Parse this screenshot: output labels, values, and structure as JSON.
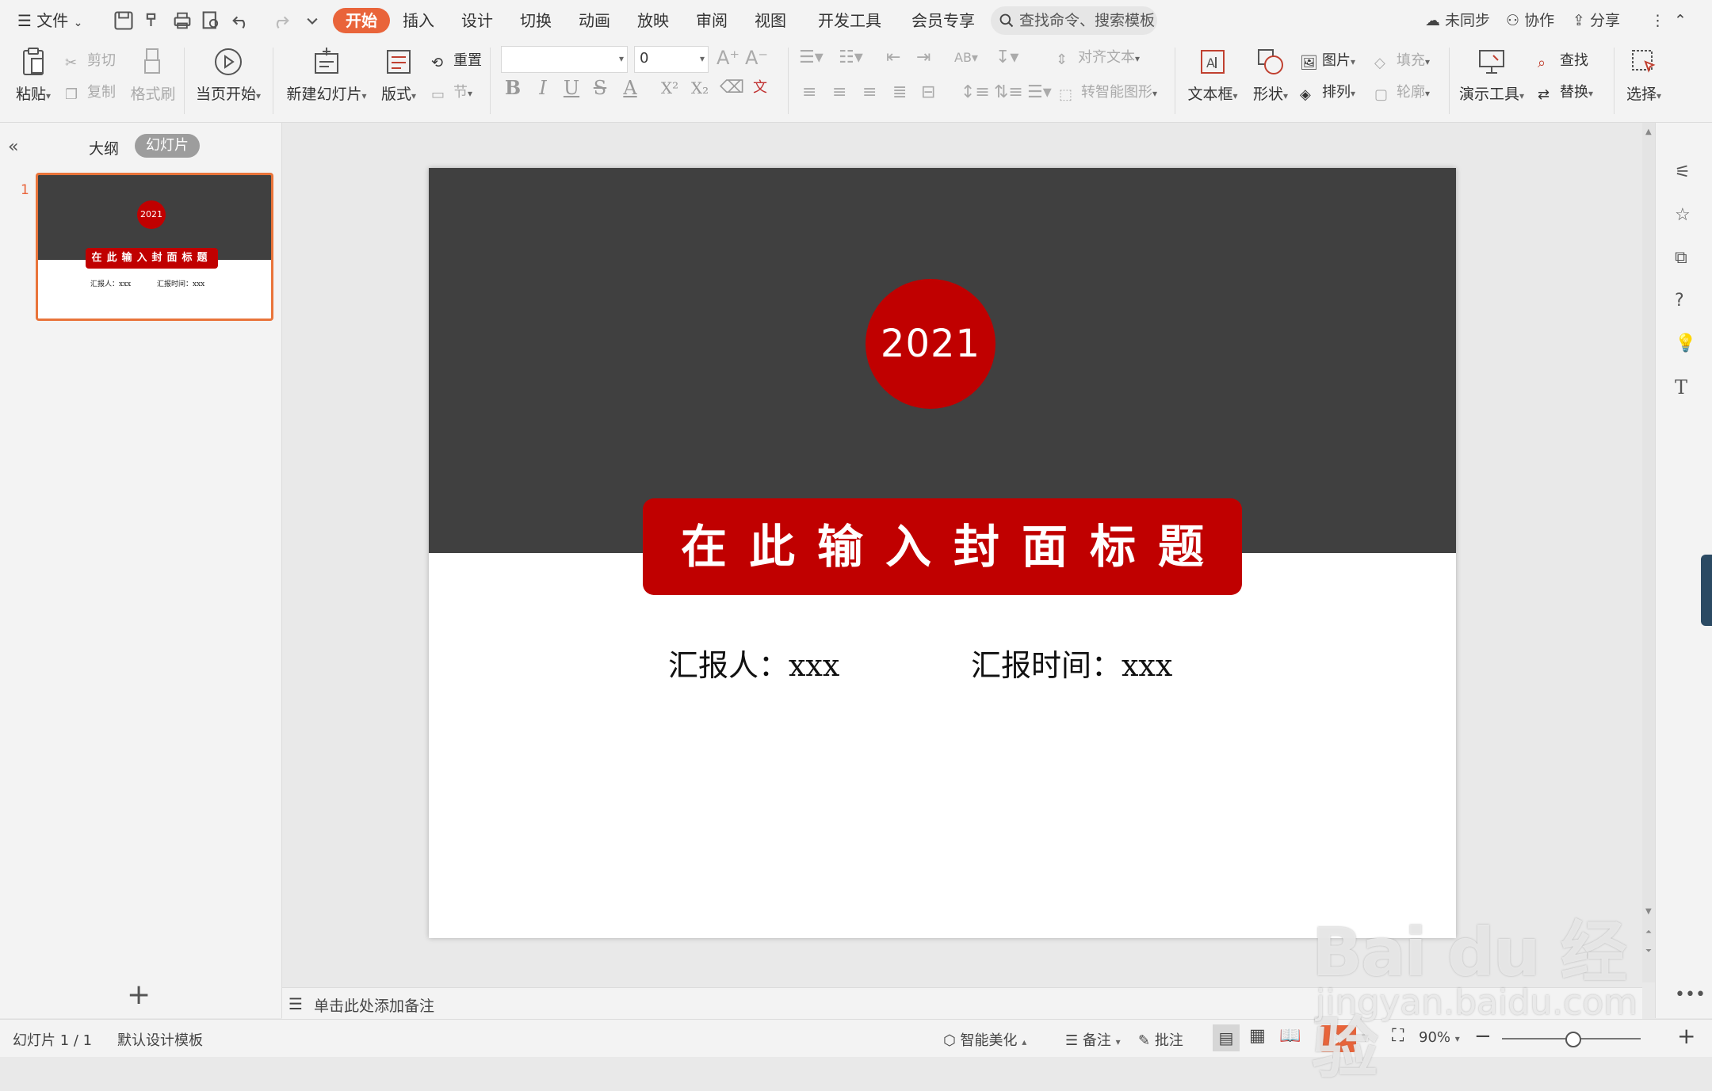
{
  "menubar": {
    "file": "文件",
    "tabs": [
      "开始",
      "插入",
      "设计",
      "切换",
      "动画",
      "放映",
      "审阅",
      "视图",
      "开发工具",
      "会员专享"
    ],
    "search_placeholder": "查找命令、搜索模板",
    "unsynced": "未同步",
    "collaborate": "协作",
    "share": "分享"
  },
  "ribbon": {
    "paste": "粘贴",
    "cut": "剪切",
    "copy": "复制",
    "format_painter": "格式刷",
    "from_current": "当页开始",
    "new_slide": "新建幻灯片",
    "layout": "版式",
    "reset": "重置",
    "section": "节",
    "font_size": "0",
    "align_text": "对齐文本",
    "smart_shape": "转智能图形",
    "textbox": "文本框",
    "shapes": "形状",
    "picture": "图片",
    "arrange": "排列",
    "fill": "填充",
    "outline": "轮廓",
    "present_tools": "演示工具",
    "find": "查找",
    "replace": "替换",
    "select": "选择"
  },
  "left_panel": {
    "tab_outline": "大纲",
    "tab_slides": "幻灯片",
    "slide_number": "1"
  },
  "slide": {
    "year": "2021",
    "title": "在此输入封面标题",
    "reporter": "汇报人：xxx",
    "report_time": "汇报时间：xxx",
    "colors": {
      "band": "#404040",
      "accent": "#c00000"
    }
  },
  "notes": {
    "placeholder": "单击此处添加备注"
  },
  "statusbar": {
    "slide_count": "幻灯片 1 / 1",
    "template": "默认设计模板",
    "beautify": "智能美化",
    "notes": "备注",
    "comments": "批注",
    "zoom": "90%"
  },
  "watermark": {
    "main": "Bai du 经验",
    "sub": "jingyan.baidu.com"
  }
}
